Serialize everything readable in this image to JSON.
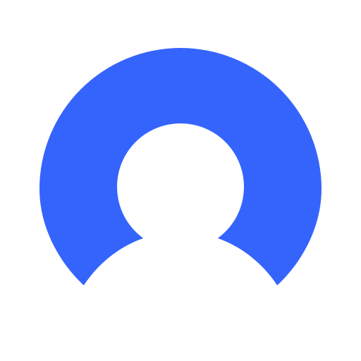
{
  "icon": {
    "name": "user-avatar-icon",
    "accent_color": "#3564FD",
    "foreground_color": "#FFFFFF",
    "background_color": "#FFFFFF"
  }
}
